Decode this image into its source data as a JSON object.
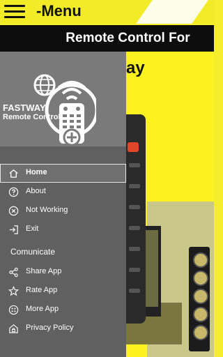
{
  "topbar": {
    "title": "-Menu"
  },
  "titlebar": {
    "title": "Remote Control For"
  },
  "background": {
    "partial_word": "ay"
  },
  "drawer": {
    "brand_line1": "FASTWAY",
    "brand_line2": "Remote Control",
    "items": [
      {
        "label": "Home",
        "icon": "home-icon",
        "active": true
      },
      {
        "label": "About",
        "icon": "help-circle-icon"
      },
      {
        "label": "Not Working",
        "icon": "cancel-circle-icon"
      },
      {
        "label": "Exit",
        "icon": "exit-icon"
      }
    ],
    "section_title": "Comunicate",
    "communicate_items": [
      {
        "label": "Share App",
        "icon": "share-icon"
      },
      {
        "label": "Rate App",
        "icon": "star-icon"
      },
      {
        "label": "More App",
        "icon": "more-apps-icon"
      },
      {
        "label": "Privacy Policy",
        "icon": "privacy-icon"
      }
    ]
  },
  "colors": {
    "accent": "#f2eb27",
    "drawer": "#606060",
    "header": "#7a7a7a",
    "titlebar": "#0d0d0d"
  }
}
